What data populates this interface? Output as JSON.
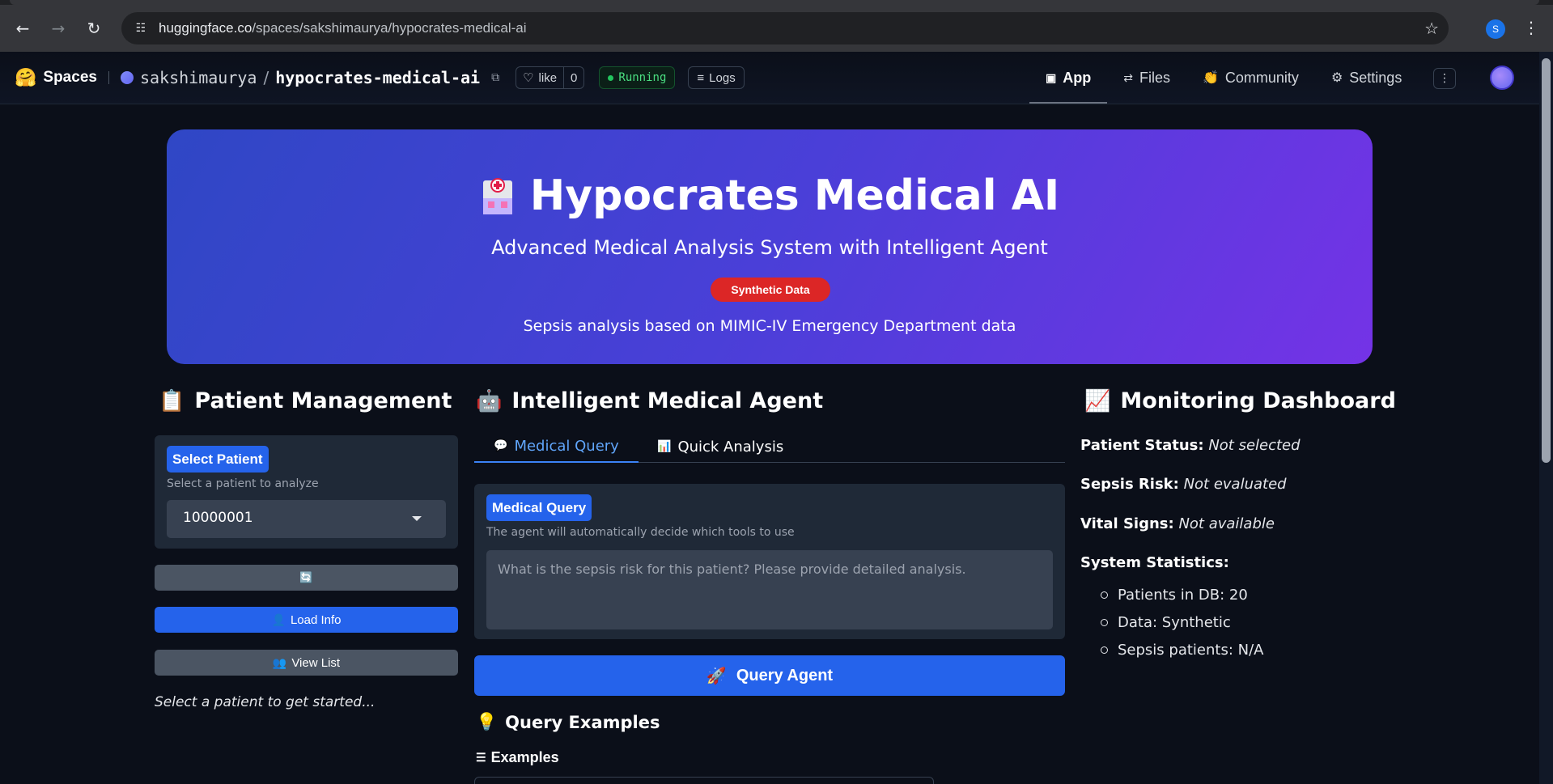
{
  "browser": {
    "url_host": "huggingface.co",
    "url_path": "/spaces/sakshimaurya/hypocrates-medical-ai",
    "profile_initial": "S"
  },
  "hf": {
    "spaces_label": "Spaces",
    "owner": "sakshimaurya",
    "separator": "/",
    "repo": "hypocrates-medical-ai",
    "like_label": "like",
    "like_count": "0",
    "status": "Running",
    "logs_label": "Logs",
    "nav": [
      {
        "label": "App",
        "icon": "cube-icon"
      },
      {
        "label": "Files",
        "icon": "files-icon"
      },
      {
        "label": "Community",
        "icon": "community-icon"
      },
      {
        "label": "Settings",
        "icon": "gear-icon"
      }
    ]
  },
  "hero": {
    "title": "Hypocrates Medical AI",
    "subtitle": "Advanced Medical Analysis System with Intelligent Agent",
    "badge": "Synthetic Data",
    "note": "Sepsis analysis based on MIMIC-IV Emergency Department data"
  },
  "patient": {
    "title": "Patient Management",
    "select_label": "Select Patient",
    "select_info": "Select a patient to analyze",
    "selected_value": "10000001",
    "refresh_icon": "🔄",
    "load_label": "Load Info",
    "view_label": "View List",
    "hint": "Select a patient to get started..."
  },
  "agent": {
    "title": "Intelligent Medical Agent",
    "tabs": [
      {
        "label": "Medical Query",
        "icon": "💬"
      },
      {
        "label": "Quick Analysis",
        "icon": "📊"
      }
    ],
    "query_label": "Medical Query",
    "query_info": "The agent will automatically decide which tools to use",
    "query_placeholder": "What is the sepsis risk for this patient? Please provide detailed analysis.",
    "query_button": "Query Agent",
    "examples_title": "Query Examples",
    "examples_label": "Examples"
  },
  "monitor": {
    "title": "Monitoring Dashboard",
    "patient_status_label": "Patient Status:",
    "patient_status_value": "Not selected",
    "sepsis_label": "Sepsis Risk:",
    "sepsis_value": "Not evaluated",
    "vitals_label": "Vital Signs:",
    "vitals_value": "Not available",
    "stats_label": "System Statistics:",
    "stats": [
      "Patients in DB: 20",
      "Data: Synthetic",
      "Sepsis patients: N/A"
    ]
  },
  "colors": {
    "accent": "#2563eb",
    "badge_red": "#dc2626",
    "running_green": "#22c55e"
  }
}
